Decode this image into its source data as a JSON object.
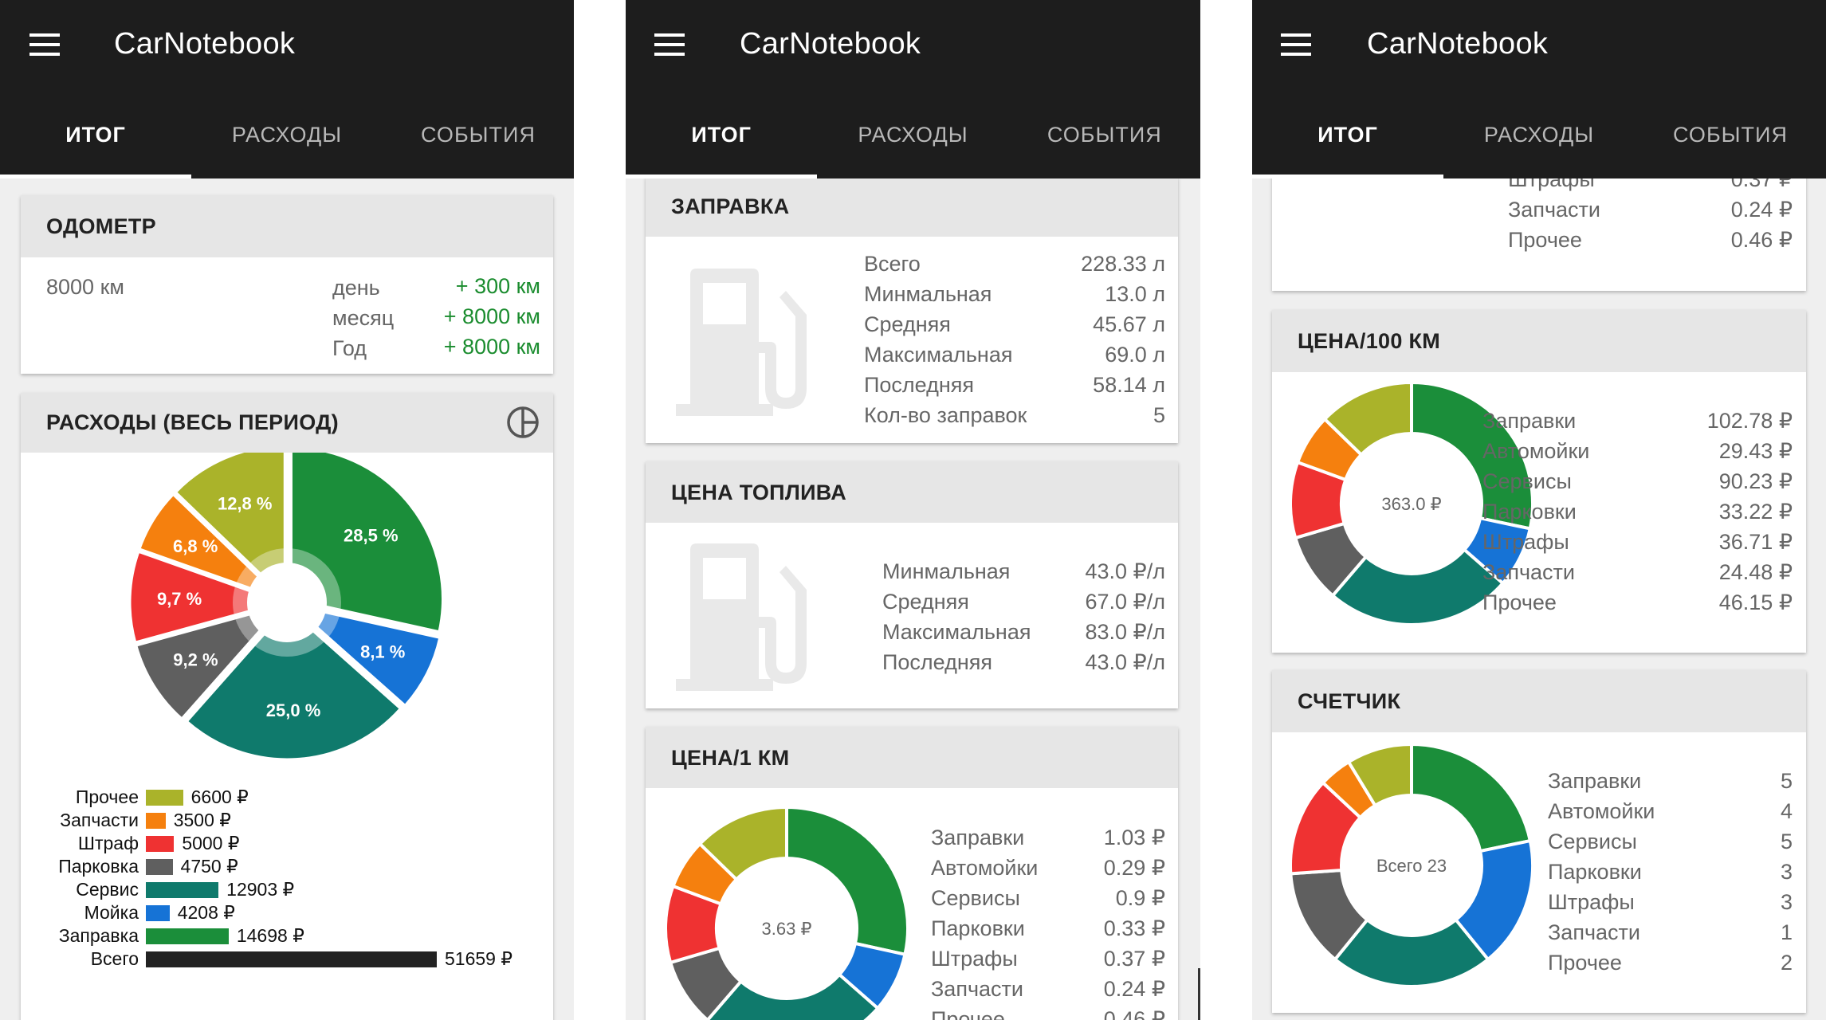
{
  "app": {
    "title": "CarNotebook"
  },
  "tabs": [
    "ИТОГ",
    "РАСХОДЫ",
    "СОБЫТИЯ"
  ],
  "colors": {
    "green": "#1b8e3a",
    "blue": "#1673d6",
    "teal": "#0f7a6c",
    "gray": "#5f5f5f",
    "red": "#ef3232",
    "orange": "#f5800e",
    "olive": "#aab32a",
    "black": "#222222",
    "appbar": "#1d1d1d"
  },
  "odometer": {
    "title": "ОДОМЕТР",
    "total": "8000 км",
    "rows": [
      {
        "label": "день",
        "value": "+ 300 км"
      },
      {
        "label": "месяц",
        "value": "+ 8000 км"
      },
      {
        "label": "Год",
        "value": "+ 8000 км"
      }
    ]
  },
  "expenses": {
    "title": "РАСХОДЫ (ВЕСЬ ПЕРИОД)",
    "pie_icon": "pie-chart-icon",
    "slices": [
      {
        "name": "Заправка",
        "percent": 28.5,
        "label": "28,5 %",
        "color": "#1b8e3a"
      },
      {
        "name": "Мойка",
        "percent": 8.1,
        "label": "8,1 %",
        "color": "#1673d6"
      },
      {
        "name": "Сервис",
        "percent": 25.0,
        "label": "25,0 %",
        "color": "#0f7a6c"
      },
      {
        "name": "Парковка",
        "percent": 9.2,
        "label": "9,2 %",
        "color": "#5f5f5f"
      },
      {
        "name": "Штраф",
        "percent": 9.7,
        "label": "9,7 %",
        "color": "#ef3232"
      },
      {
        "name": "Запчасти",
        "percent": 6.8,
        "label": "6,8 %",
        "color": "#f5800e"
      },
      {
        "name": "Прочее",
        "percent": 12.8,
        "label": "12,8 %",
        "color": "#aab32a"
      }
    ],
    "bars": [
      {
        "name": "Прочее",
        "value": 6600,
        "label": "6600 ₽",
        "color": "#aab32a"
      },
      {
        "name": "Запчасти",
        "value": 3500,
        "label": "3500 ₽",
        "color": "#f5800e"
      },
      {
        "name": "Штраф",
        "value": 5000,
        "label": "5000 ₽",
        "color": "#ef3232"
      },
      {
        "name": "Парковка",
        "value": 4750,
        "label": "4750 ₽",
        "color": "#5f5f5f"
      },
      {
        "name": "Сервис",
        "value": 12903,
        "label": "12903 ₽",
        "color": "#0f7a6c"
      },
      {
        "name": "Мойка",
        "value": 4208,
        "label": "4208 ₽",
        "color": "#1673d6"
      },
      {
        "name": "Заправка",
        "value": 14698,
        "label": "14698 ₽",
        "color": "#1b8e3a"
      },
      {
        "name": "Всего",
        "value": 51659,
        "label": "51659 ₽",
        "color": "#222222"
      }
    ]
  },
  "refuel": {
    "title": "ЗАПРАВКА",
    "icon": "fuel-pump-icon",
    "rows": [
      {
        "label": "Всего",
        "value": "228.33 л"
      },
      {
        "label": "Минмальная",
        "value": "13.0 л"
      },
      {
        "label": "Средняя",
        "value": "45.67 л"
      },
      {
        "label": "Максимальная",
        "value": "69.0 л"
      },
      {
        "label": "Последняя",
        "value": "58.14 л"
      },
      {
        "label": "Кол-во заправок",
        "value": "5"
      }
    ]
  },
  "fuel_price": {
    "title": "ЦЕНА ТОПЛИВА",
    "icon": "fuel-pump-icon",
    "rows": [
      {
        "label": "Минмальная",
        "value": "43.0 ₽/л"
      },
      {
        "label": "Средняя",
        "value": "67.0 ₽/л"
      },
      {
        "label": "Максимальная",
        "value": "83.0 ₽/л"
      },
      {
        "label": "Последняя",
        "value": "43.0 ₽/л"
      }
    ]
  },
  "price_per_km": {
    "title": "ЦЕНА/1 КМ",
    "center": "3.63 ₽",
    "rows": [
      {
        "label": "Заправки",
        "value": "1.03 ₽"
      },
      {
        "label": "Автомойки",
        "value": "0.29 ₽"
      },
      {
        "label": "Сервисы",
        "value": "0.9 ₽"
      },
      {
        "label": "Парковки",
        "value": "0.33 ₽"
      },
      {
        "label": "Штрафы",
        "value": "0.37 ₽"
      },
      {
        "label": "Запчасти",
        "value": "0.24 ₽"
      },
      {
        "label": "Прочее",
        "value": "0.46 ₽"
      }
    ]
  },
  "partial_card": {
    "rows": [
      {
        "label": "Штрафы",
        "value": "0.37 ₽"
      },
      {
        "label": "Запчасти",
        "value": "0.24 ₽"
      },
      {
        "label": "Прочее",
        "value": "0.46 ₽"
      }
    ]
  },
  "price_per_100": {
    "title": "ЦЕНА/100 КМ",
    "center": "363.0 ₽",
    "rows": [
      {
        "label": "Заправки",
        "value": "102.78 ₽"
      },
      {
        "label": "Автомойки",
        "value": "29.43 ₽"
      },
      {
        "label": "Сервисы",
        "value": "90.23 ₽"
      },
      {
        "label": "Парковки",
        "value": "33.22 ₽"
      },
      {
        "label": "Штрафы",
        "value": "36.71 ₽"
      },
      {
        "label": "Запчасти",
        "value": "24.48 ₽"
      },
      {
        "label": "Прочее",
        "value": "46.15 ₽"
      }
    ]
  },
  "counter": {
    "title": "СЧЕТЧИК",
    "center": "Всего 23",
    "rows": [
      {
        "label": "Заправки",
        "value": "5"
      },
      {
        "label": "Автомойки",
        "value": "4"
      },
      {
        "label": "Сервисы",
        "value": "5"
      },
      {
        "label": "Парковки",
        "value": "3"
      },
      {
        "label": "Штрафы",
        "value": "3"
      },
      {
        "label": "Запчасти",
        "value": "1"
      },
      {
        "label": "Прочее",
        "value": "2"
      }
    ]
  },
  "chart_data": [
    {
      "type": "pie",
      "title": "РАСХОДЫ (ВЕСЬ ПЕРИОД)",
      "categories": [
        "Заправка",
        "Мойка",
        "Сервис",
        "Парковка",
        "Штраф",
        "Запчасти",
        "Прочее"
      ],
      "values": [
        28.5,
        8.1,
        25.0,
        9.2,
        9.7,
        6.8,
        12.8
      ]
    },
    {
      "type": "bar",
      "categories": [
        "Прочее",
        "Запчасти",
        "Штраф",
        "Парковка",
        "Сервис",
        "Мойка",
        "Заправка",
        "Всего"
      ],
      "values": [
        6600,
        3500,
        5000,
        4750,
        12903,
        4208,
        14698,
        51659
      ]
    },
    {
      "type": "pie",
      "title": "ЦЕНА/1 КМ",
      "categories": [
        "Заправки",
        "Автомойки",
        "Сервисы",
        "Парковки",
        "Штрафы",
        "Запчасти",
        "Прочее"
      ],
      "values": [
        1.03,
        0.29,
        0.9,
        0.33,
        0.37,
        0.24,
        0.46
      ]
    },
    {
      "type": "pie",
      "title": "ЦЕНА/100 КМ",
      "categories": [
        "Заправки",
        "Автомойки",
        "Сервисы",
        "Парковки",
        "Штрафы",
        "Запчасти",
        "Прочее"
      ],
      "values": [
        102.78,
        29.43,
        90.23,
        33.22,
        36.71,
        24.48,
        46.15
      ]
    },
    {
      "type": "pie",
      "title": "СЧЕТЧИК",
      "categories": [
        "Заправки",
        "Автомойки",
        "Сервисы",
        "Парковки",
        "Штрафы",
        "Запчасти",
        "Прочее"
      ],
      "values": [
        5,
        4,
        5,
        3,
        3,
        1,
        2
      ]
    }
  ]
}
